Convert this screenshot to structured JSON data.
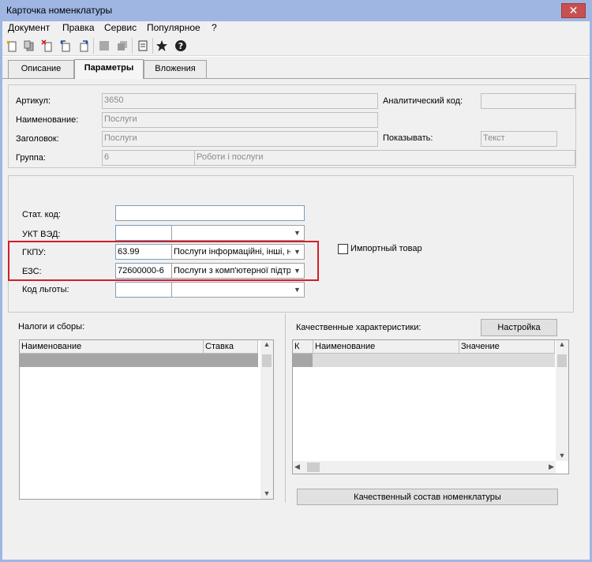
{
  "window": {
    "title": "Карточка номенклатуры",
    "close_glyph": "✕"
  },
  "menu": [
    "Документ",
    "Правка",
    "Сервис",
    "Популярное",
    "?"
  ],
  "toolbar_icons": [
    "new-document-icon",
    "copy-document-icon",
    "delete-document-icon",
    "return-icon",
    "forward-icon",
    "disabled-square-icon",
    "disabled-copy-icon",
    "page-icon",
    "star-icon",
    "help-icon"
  ],
  "tabs": [
    "Описание",
    "Параметры",
    "Вложения"
  ],
  "fields": {
    "article": {
      "label": "Артикул:",
      "value": "3650"
    },
    "analytic_code": {
      "label": "Аналитический код:",
      "value": ""
    },
    "name": {
      "label": "Наименование:",
      "value": "Послуги"
    },
    "header": {
      "label": "Заголовок:",
      "value": "Послуги"
    },
    "show": {
      "label": "Показывать:",
      "value": "Текст"
    },
    "group": {
      "label": "Группа:",
      "code": "6",
      "value": "Роботи і послуги"
    }
  },
  "codes": {
    "stat_code": {
      "label": "Стат. код:",
      "value": ""
    },
    "ukt": {
      "label": "УКТ ВЭД:",
      "code": "",
      "value": ""
    },
    "gkpu": {
      "label": "ГКПУ:",
      "code": "63.99",
      "value": "Послуги інформаційні, інші, н"
    },
    "ezs": {
      "label": "ЕЗС:",
      "code": "72600000-6",
      "value": "Послуги з комп'ютерної підтр"
    },
    "benefit": {
      "label": "Код льготы:",
      "code": "",
      "value": ""
    },
    "import_label": "Импортный товар"
  },
  "taxes": {
    "title": "Налоги и сборы:",
    "columns": [
      "Наименование",
      "Ставка"
    ]
  },
  "qualities": {
    "title": "Качественные характеристики:",
    "settings_button": "Настройка",
    "columns": [
      "К",
      "Наименование",
      "Значение"
    ],
    "composition_button": "Качественный состав номенклатуры"
  },
  "colors": {
    "title_bar": "#9fb6e3",
    "highlight": "#d01f2a",
    "selected_row": "#a6a6a6"
  }
}
